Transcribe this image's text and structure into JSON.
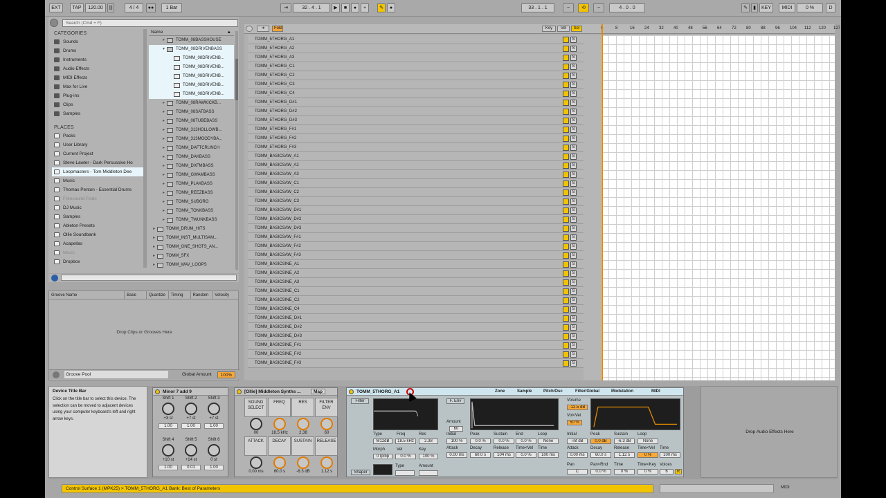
{
  "transport": {
    "ext": "EXT",
    "tap": "TAP",
    "tempo": "120.00",
    "sig": "4 / 4",
    "quant": "1 Bar",
    "position": "32 .  4 .  1",
    "loop_start": "33 .  1 .  1",
    "loop_len": "4 .  0 .  0",
    "key": "KEY",
    "midi": "MIDI",
    "cpu": "0 %",
    "d": "D"
  },
  "browser": {
    "search_placeholder": "Search (Cmd + F)",
    "categories_title": "CATEGORIES",
    "categories": [
      "Sounds",
      "Drums",
      "Instruments",
      "Audio Effects",
      "MIDI Effects",
      "Max for Live",
      "Plug-ins",
      "Clips",
      "Samples"
    ],
    "places_title": "PLACES",
    "places": [
      "Packs",
      "User Library",
      "Current Project",
      "Steve Lawler - Dark Percussive Ho",
      "Loopmasters - Tom Middleton Dee",
      "Music",
      "Thomas Penton - Essential Drums",
      "Freesound Finds",
      "DJ Music",
      "Samples",
      "Ableton Presets",
      "Ollie Soundbank",
      "Acapellas",
      "Music",
      "Dropbox"
    ],
    "name_header": "Name",
    "files": [
      "TOMM_08BASSHOUSE",
      "TOMM_08DRIVENBASS",
      "TOMM_08DRIVENB...",
      "TOMM_08DRIVENB...",
      "TOMM_08DRIVENB...",
      "TOMM_08DRIVENB...",
      "TOMM_08DRIVENB...",
      "TOMM_08RAWKICKB...",
      "TOMM_08SATBASS",
      "TOMM_08TUBEBASS",
      "TOMM_313HOLLOWB...",
      "TOMM_313MOODYBA...",
      "TOMM_DAFTCRUNCH",
      "TOMM_DAKBASS",
      "TOMM_DXFMBASS",
      "TOMM_GWAMBASS",
      "TOMM_PLAKBASS",
      "TOMM_REEZBASS",
      "TOMM_SUBORG",
      "TOMM_TONKBASS",
      "TOMM_TWUNKBASS",
      "TOMM_DRUM_HITS",
      "TOMM_INST_MULTISAM...",
      "TOMM_ONE_SHOTS_AN...",
      "TOMM_SFX",
      "TOMM_WAV_LOOPS"
    ]
  },
  "groove": {
    "headers": [
      "Groove Name",
      "Base",
      "Quantize",
      "Timing",
      "Random",
      "Velocity"
    ],
    "drop_text": "Drop Clips or Grooves Here",
    "title": "Groove Pool",
    "global_amount_label": "Global Amount",
    "global_amount": "100%"
  },
  "main": {
    "btn_fold": "Fold",
    "btn_key": "Key",
    "btn_vel": "Vel",
    "btn_sel": "Sel",
    "ruler": [
      "0",
      "8",
      "16",
      "24",
      "32",
      "40",
      "48",
      "56",
      "64",
      "72",
      "80",
      "88",
      "96",
      "104",
      "112",
      "120",
      "127"
    ],
    "tracks": [
      "TOMM_5THORG_A1",
      "TOMM_5THORG_A2",
      "TOMM_5THORG_A3",
      "TOMM_5THORG_C1",
      "TOMM_5THORG_C2",
      "TOMM_5THORG_C3",
      "TOMM_5THORG_C4",
      "TOMM_5THORG_D#1",
      "TOMM_5THORG_D#2",
      "TOMM_5THORG_D#3",
      "TOMM_5THORG_F#1",
      "TOMM_5THORG_F#2",
      "TOMM_5THORG_F#3",
      "TOMM_BASICSAW_A1",
      "TOMM_BASICSAW_A2",
      "TOMM_BASICSAW_A3",
      "TOMM_BASICSAW_C1",
      "TOMM_BASICSAW_C2",
      "TOMM_BASICSAW_C3",
      "TOMM_BASICSAW_D#1",
      "TOMM_BASICSAW_D#2",
      "TOMM_BASICSAW_D#3",
      "TOMM_BASICSAW_F#1",
      "TOMM_BASICSAW_F#2",
      "TOMM_BASICSAW_F#3",
      "TOMM_BASICSINE_A1",
      "TOMM_BASICSINE_A2",
      "TOMM_BASICSINE_A3",
      "TOMM_BASICSINE_C1",
      "TOMM_BASICSINE_C2",
      "TOMM_BASICSINE_C4",
      "TOMM_BASICSINE_D#1",
      "TOMM_BASICSINE_D#2",
      "TOMM_BASICSINE_D#3",
      "TOMM_BASICSINE_F#1",
      "TOMM_BASICSINE_F#2",
      "TOMM_BASICSINE_F#3"
    ],
    "solo": "S"
  },
  "info": {
    "title": "Device Title Bar",
    "text": "Click on the title bar to select this device. The selection can be moved to adjacent devices using your computer keyboard's left and right arrow keys."
  },
  "chord": {
    "title": "Minor 7 add 9",
    "labels": [
      "Shift 1",
      "Shift 2",
      "Shift 3",
      "Shift 4",
      "Shift 5",
      "Shift 6"
    ],
    "shifts": [
      "+3 st",
      "+7 st",
      "+7 st",
      "+10 st",
      "+14 st",
      "0 st"
    ],
    "vals": [
      "1.00",
      "1.00",
      "1.00",
      "1.00",
      "0.01",
      "1.00"
    ]
  },
  "rack": {
    "title": "[Ollie] Middleton Synths ...",
    "map": "Map",
    "labels": [
      "SOUND SELECT",
      "FREQ",
      "RES",
      "FILTER ENV",
      "ATTACK",
      "DECAY",
      "SUSTAIN",
      "RELEASE"
    ],
    "vals": [
      "00",
      "18.5 kHz",
      "2.38",
      "60",
      "0.00 ms",
      "60.0 s",
      "-6.3 dB",
      "1.12 s"
    ]
  },
  "sampler": {
    "title": "TOMM_5THORG_A1",
    "tabs": [
      "Zone",
      "Sample",
      "Pitch/Osc",
      "Filter/Global",
      "Modulation",
      "MIDI"
    ],
    "filter_label": "Filter",
    "fenv_label": "F. Env",
    "type_lbl": "Type",
    "type_val": "M12dB",
    "freq_lbl": "Freq",
    "freq_val": "18.5 kHz",
    "res_lbl": "Res",
    "res_val": "2.38",
    "morph_lbl": "Morph",
    "morph_val": "0 lp/bp",
    "vel_lbl": "Vel",
    "vel_val": "0.0 %",
    "key_lbl": "Key",
    "key_val": "100 %",
    "shaper": "Shaper",
    "shaper_type": "Type",
    "shaper_amount": "Amount",
    "amount_lbl": "Amount",
    "amount_val": "60",
    "fenv_lbls": [
      "Initial",
      "Peak",
      "Sustain",
      "End",
      "Loop"
    ],
    "fenv_vals": [
      "100 %",
      "0.0 %",
      "0.0 %",
      "0.0 %",
      "None"
    ],
    "fenv_lbls2": [
      "Attack",
      "Decay",
      "Release",
      "Time<Vel",
      "Time"
    ],
    "fenv_vals2": [
      "0.00 ms",
      "60.0 s",
      "104 ms",
      "0.0 %",
      "100 ms"
    ],
    "vol_lbl": "Volume",
    "vol_val": "-12.5 dB",
    "volvel_lbl": "Vol<Vel",
    "volvel_val": "50 %",
    "aenv_lbls": [
      "Initial",
      "Peak",
      "Sustain",
      "Loop"
    ],
    "aenv_vals": [
      "-inf dB",
      "0.0 dB",
      "-6.3 dB",
      "None"
    ],
    "aenv_lbls2": [
      "Attack",
      "Decay",
      "Release",
      "Time<Vel",
      "Time"
    ],
    "aenv_vals2": [
      "0.00 ms",
      "60.0 s",
      "1.12 s",
      "0 %",
      "100 ms"
    ],
    "pan_lbl": "Pan",
    "pan_val": "C",
    "panrnd_lbl": "Pan<Rnd",
    "panrnd_val": "0.0 %",
    "time_lbl": "Time",
    "time_val": "0 %",
    "timekey_lbl": "Time<Key",
    "timekey_val": "0 %",
    "voices_lbl": "Voices",
    "voices_val": "6",
    "r": "R"
  },
  "fx_drop": "Drop Audio Effects Here",
  "status": "Control Surface 1 (MPK25) > TOMM_5THORG_A1 Bank: Best of Parameters",
  "status_midi": "MIDI"
}
